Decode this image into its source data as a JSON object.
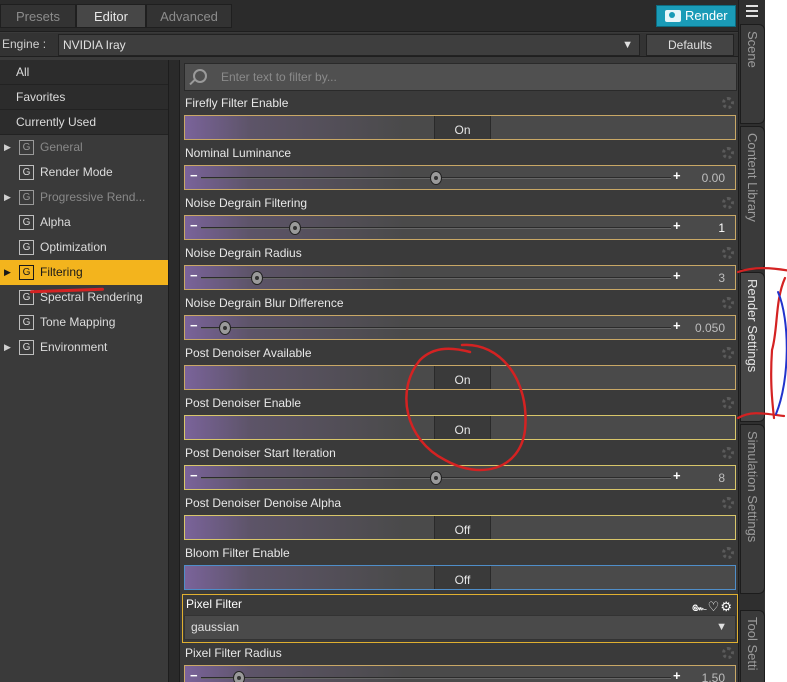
{
  "tabs": {
    "presets": "Presets",
    "editor": "Editor",
    "advanced": "Advanced"
  },
  "render_button": "Render",
  "engine": {
    "label": "Engine :",
    "value": "NVIDIA Iray",
    "defaults": "Defaults"
  },
  "categories": {
    "all": "All",
    "favorites": "Favorites",
    "currently_used": "Currently Used",
    "groups": [
      {
        "label": "General",
        "icon": "G"
      },
      {
        "label": "Render Mode",
        "icon": "G"
      },
      {
        "label": "Progressive Rend...",
        "icon": "G"
      },
      {
        "label": "Alpha",
        "icon": "G"
      },
      {
        "label": "Optimization",
        "icon": "G"
      },
      {
        "label": "Filtering",
        "icon": "G"
      },
      {
        "label": "Spectral Rendering",
        "icon": "G"
      },
      {
        "label": "Tone Mapping",
        "icon": "G"
      },
      {
        "label": "Environment",
        "icon": "G"
      }
    ]
  },
  "filter": {
    "placeholder": "Enter text to filter by..."
  },
  "properties": [
    {
      "label": "Firefly Filter Enable",
      "value": "On"
    },
    {
      "label": "Nominal Luminance",
      "value": "0.00",
      "level": 0.5
    },
    {
      "label": "Noise Degrain Filtering",
      "value": "1",
      "level": 0.2
    },
    {
      "label": "Noise Degrain Radius",
      "value": "3",
      "level": 0.12
    },
    {
      "label": "Noise Degrain Blur Difference",
      "value": "0.050",
      "level": 0.05
    },
    {
      "label": "Post Denoiser Available",
      "value": "On"
    },
    {
      "label": "Post Denoiser Enable",
      "value": "On"
    },
    {
      "label": "Post Denoiser Start Iteration",
      "value": "8",
      "level": 0.5
    },
    {
      "label": "Post Denoiser Denoise Alpha",
      "value": "Off"
    },
    {
      "label": "Bloom Filter Enable",
      "value": "Off"
    },
    {
      "label": "Pixel Filter",
      "value": "gaussian"
    },
    {
      "label": "Pixel Filter Radius",
      "value": "1.50",
      "level": 0.08
    }
  ],
  "side_tabs": {
    "scene": "Scene",
    "content_library": "Content Library",
    "render_settings": "Render Settings",
    "simulation_settings": "Simulation Settings",
    "tool_settings": "Tool Setti"
  },
  "icons": {
    "search": "search-icon",
    "gear": "gear-icon",
    "camera": "camera-icon",
    "menu": "menu-icon",
    "chevron": "chevron-down-icon",
    "pixel_filter_icons": "๛♡⚙"
  },
  "colors": {
    "accent_render": "#1a9bb7",
    "selected_category": "#f3b41d",
    "annotation_red": "#d42222",
    "annotation_blue": "#2233cc"
  }
}
